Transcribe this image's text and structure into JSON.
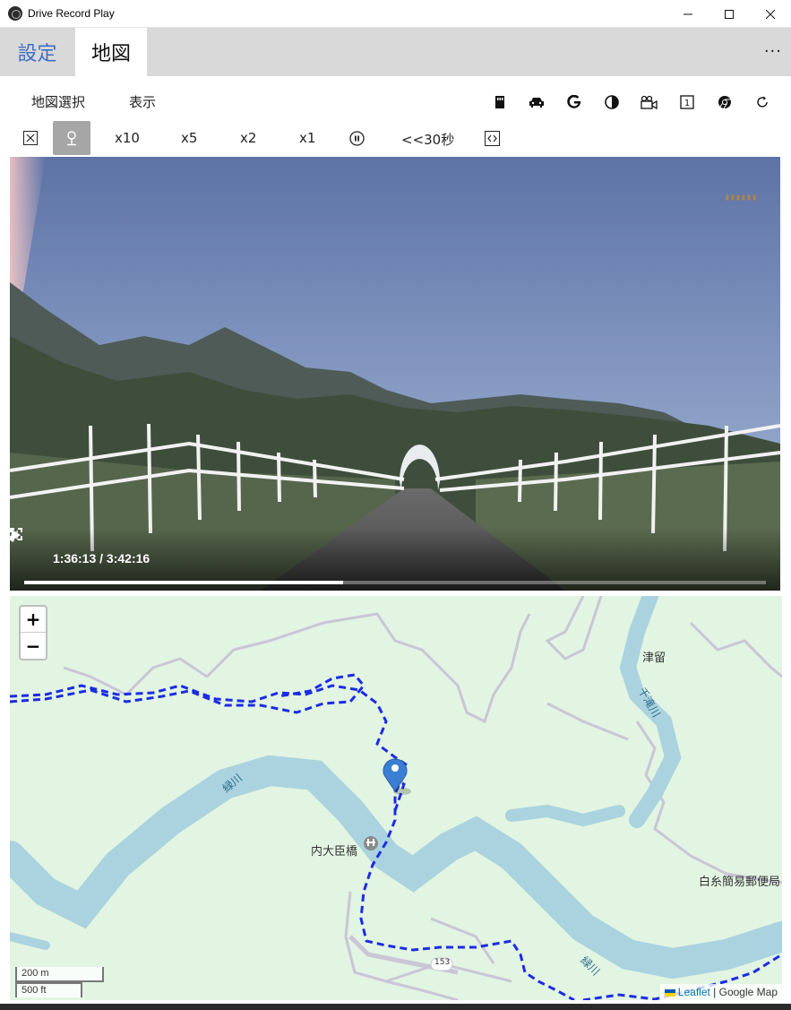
{
  "window": {
    "title": "Drive Record Play"
  },
  "tabs": {
    "settings": "設定",
    "map": "地図"
  },
  "more_label": "···",
  "toolbar1": {
    "map_select": "地図選択",
    "display": "表示",
    "icons": [
      "sd-card-icon",
      "car-icon",
      "google-icon",
      "contrast-icon",
      "camera-icon",
      "one-icon",
      "chrome-icon",
      "refresh-icon"
    ],
    "one_label": "1"
  },
  "toolbar2": {
    "speeds": [
      "x10",
      "x5",
      "x2",
      "x1"
    ],
    "rewind": "<<30秒"
  },
  "video": {
    "current_time": "1:36:13",
    "duration": "3:42:16",
    "time_display": "1:36:13 / 3:42:16",
    "progress_fraction": 0.43
  },
  "map": {
    "zoom_in": "+",
    "zoom_out": "−",
    "labels": {
      "tsuru": "津留",
      "sentaki": "千滝川",
      "midori1": "緑川",
      "midori2": "緑川",
      "bridge": "内大臣橋",
      "post": "白糸簡易郵便局",
      "route": "153"
    },
    "scale_metric": "200 m",
    "scale_imperial": "500 ft",
    "attribution_leaflet": "Leaflet",
    "attribution_sep": " | ",
    "attribution_google": "Google Map",
    "colors": {
      "land": "#e2f4e2",
      "river": "#aad3df",
      "track": "#1c2be6",
      "marker": "#3b7fd4"
    }
  }
}
